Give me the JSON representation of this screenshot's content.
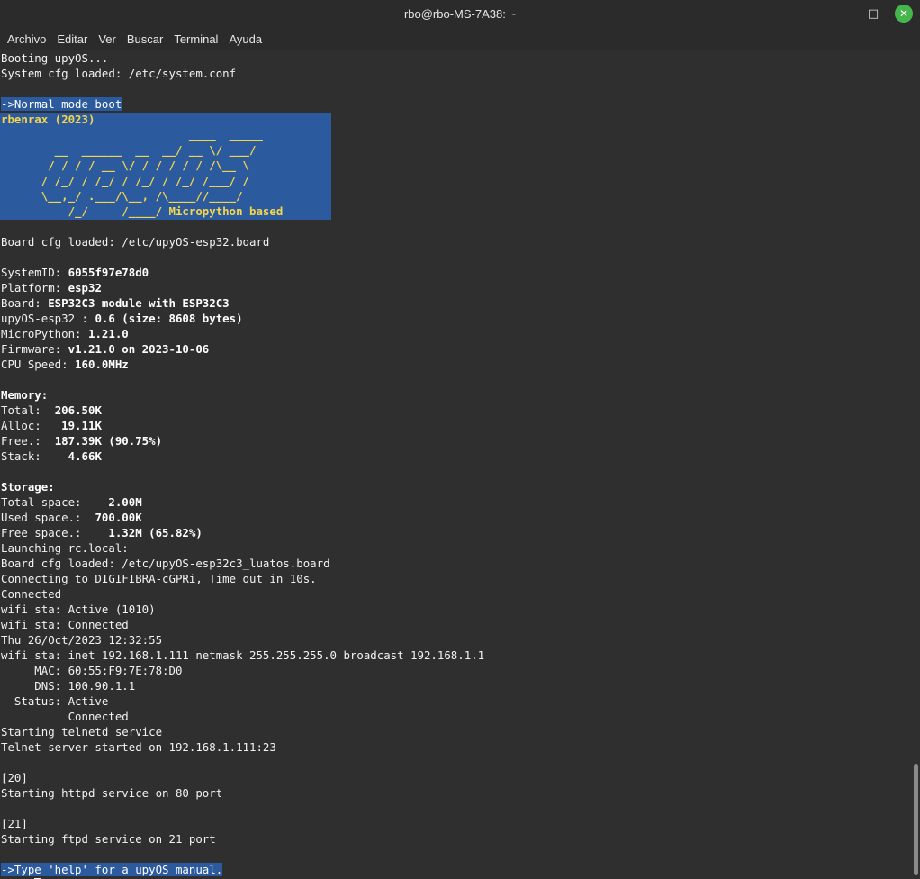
{
  "window": {
    "title": "rbo@rbo-MS-7A38: ~",
    "minimize_glyph": "–",
    "maximize_glyph": "□",
    "close_glyph": "✕"
  },
  "menu": [
    "Archivo",
    "Editar",
    "Ver",
    "Buscar",
    "Terminal",
    "Ayuda"
  ],
  "terminal": {
    "boot": [
      "Booting upyOS...",
      "System cfg loaded: /etc/system.conf"
    ],
    "normal_mode": "->Normal mode boot",
    "author": "rbenrax (2023)",
    "ascii": [
      "                            ____  _____",
      "        __  ______  __  __/ __ \\/ ___/",
      "       / / / / __ \\/ / / / / / /\\__ \\",
      "      / /_/ / /_/ / /_/ / /_/ /___/ /",
      "      \\__,_/ .___/\\__, /\\____//____/",
      "          /_/     /____/ "
    ],
    "ascii_tag": "Micropython based",
    "board_cfg": "Board cfg loaded: /etc/upyOS-esp32.board",
    "info": [
      {
        "label": "SystemID: ",
        "value": "6055f97e78d0"
      },
      {
        "label": "Platform: ",
        "value": "esp32"
      },
      {
        "label": "Board: ",
        "value": "ESP32C3 module with ESP32C3"
      },
      {
        "label": "upyOS-esp32 : ",
        "value": "0.6 (size: 8608 bytes)"
      },
      {
        "label": "MicroPython: ",
        "value": "1.21.0"
      },
      {
        "label": "Firmware: ",
        "value": "v1.21.0 on 2023-10-06"
      },
      {
        "label": "CPU Speed: ",
        "value": "160.0MHz"
      }
    ],
    "memory_heading": "Memory:",
    "memory": [
      {
        "label": "Total:  ",
        "value": "206.50K"
      },
      {
        "label": "Alloc:   ",
        "value": "19.11K"
      },
      {
        "label": "Free.:  ",
        "value": "187.39K (90.75%)"
      },
      {
        "label": "Stack:    ",
        "value": "4.66K"
      }
    ],
    "storage_heading": "Storage:",
    "storage": [
      {
        "label": "Total space:    ",
        "value": "2.00M"
      },
      {
        "label": "Used space.:  ",
        "value": "700.00K"
      },
      {
        "label": "Free space.:    ",
        "value": "1.32M (65.82%)"
      }
    ],
    "log": [
      "Launching rc.local:",
      "Board cfg loaded: /etc/upyOS-esp32c3_luatos.board",
      "Connecting to DIGIFIBRA-cGPRi, Time out in 10s.",
      "Connected",
      "wifi sta: Active (1010)",
      "wifi sta: Connected",
      "Thu 26/Oct/2023 12:32:55",
      "wifi sta: inet 192.168.1.111 netmask 255.255.255.0 broadcast 192.168.1.1",
      "     MAC: 60:55:F9:7E:78:D0",
      "     DNS: 100.90.1.1",
      "  Status: Active",
      "          Connected",
      "Starting telnetd service",
      "Telnet server started on 192.168.1.111:23"
    ],
    "http_pid": "[20]",
    "http_msg": "Starting httpd service on 80 port",
    "ftp_pid": "[21]",
    "ftp_msg": "Starting ftpd service on 21 port",
    "help_msg": "->Type 'help' for a upyOS manual.",
    "prompt": "/ $: "
  },
  "colors": {
    "background": "#2f2f2f",
    "selection": "#2b5a9e",
    "banner_text": "#f5d64b",
    "close_button": "#45b64c"
  }
}
